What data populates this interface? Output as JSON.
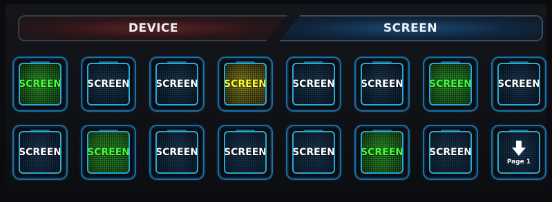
{
  "tabs": {
    "device": "DEVICE",
    "screen": "SCREEN",
    "active": "screen"
  },
  "keys": [
    {
      "label": "SCREEN",
      "state": "green"
    },
    {
      "label": "SCREEN",
      "state": "blue"
    },
    {
      "label": "SCREEN",
      "state": "blue"
    },
    {
      "label": "SCREEN",
      "state": "yellow"
    },
    {
      "label": "SCREEN",
      "state": "blue"
    },
    {
      "label": "SCREEN",
      "state": "blue"
    },
    {
      "label": "SCREEN",
      "state": "green"
    },
    {
      "label": "SCREEN",
      "state": "blue"
    },
    {
      "label": "SCREEN",
      "state": "blue"
    },
    {
      "label": "SCREEN",
      "state": "green"
    },
    {
      "label": "SCREEN",
      "state": "blue"
    },
    {
      "label": "SCREEN",
      "state": "blue"
    },
    {
      "label": "SCREEN",
      "state": "blue"
    },
    {
      "label": "SCREEN",
      "state": "green"
    },
    {
      "label": "SCREEN",
      "state": "blue"
    }
  ],
  "page_key": {
    "icon": "arrow-down-icon",
    "label": "Page 1"
  },
  "colors": {
    "green_text": "#46ff3c",
    "yellow_text": "#ffff2e",
    "blue_border": "#2aa9d8"
  }
}
